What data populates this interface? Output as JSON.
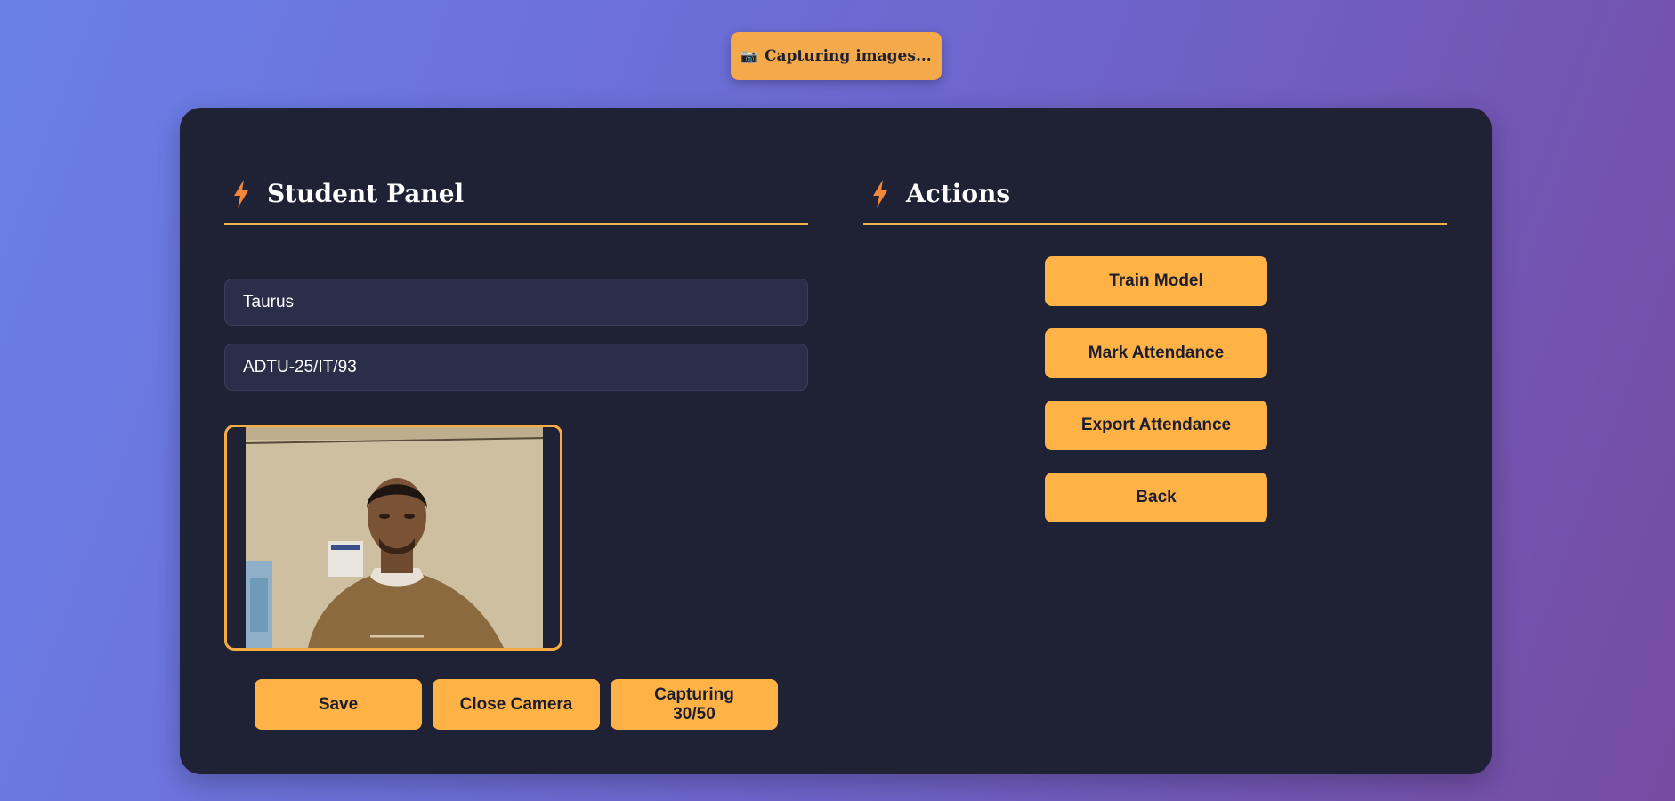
{
  "toast": {
    "icon": "camera-icon",
    "text": "Capturing images..."
  },
  "student_panel": {
    "title": "Student Panel",
    "name_value": "Taurus",
    "id_value": "ADTU-25/IT/93",
    "buttons": {
      "save": "Save",
      "close_camera": "Close Camera",
      "capture_line1": "Capturing",
      "capture_line2": "30/50"
    }
  },
  "actions": {
    "title": "Actions",
    "buttons": {
      "train": "Train Model",
      "mark": "Mark Attendance",
      "export": "Export Attendance",
      "back": "Back"
    }
  },
  "colors": {
    "accent": "#ffb347",
    "card": "#1f2135",
    "field": "#2b2e48",
    "bolt": "#f5873a"
  }
}
